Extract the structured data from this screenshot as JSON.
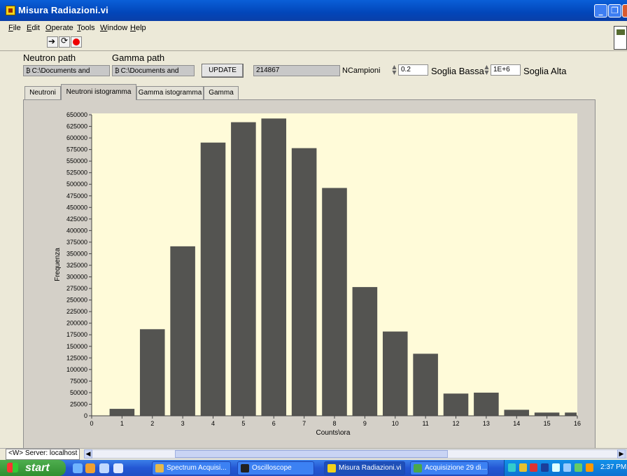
{
  "window": {
    "title": "Misura Radiazioni.vi"
  },
  "menu": [
    {
      "label": "File",
      "u": "F",
      "rest": "ile"
    },
    {
      "label": "Edit",
      "u": "E",
      "rest": "dit"
    },
    {
      "label": "Operate",
      "u": "O",
      "rest": "perate"
    },
    {
      "label": "Tools",
      "u": "T",
      "rest": "ools"
    },
    {
      "label": "Window",
      "u": "W",
      "rest": "indow"
    },
    {
      "label": "Help",
      "u": "H",
      "rest": "elp"
    }
  ],
  "controls": {
    "neutron_path_label": "Neutron path",
    "neutron_path_value": "C:\\Documents and",
    "gamma_path_label": "Gamma path",
    "gamma_path_value": "C:\\Documents and",
    "update_label": "UPDATE",
    "ncampioni_value": "214867",
    "ncampioni_label": "NCampioni",
    "soglia_bassa_value": "0.2",
    "soglia_bassa_label": "Soglia Bassa",
    "soglia_alta_value": "1E+6",
    "soglia_alta_label": "Soglia Alta"
  },
  "tabs": [
    "Neutroni",
    "Neutroni istogramma",
    "Gamma istogramma",
    "Gamma"
  ],
  "active_tab": 1,
  "chart_data": {
    "type": "bar",
    "categories": [
      1,
      2,
      3,
      4,
      5,
      6,
      7,
      8,
      9,
      10,
      11,
      12,
      13,
      14,
      15,
      16
    ],
    "values": [
      15000,
      187000,
      366000,
      590000,
      634000,
      642000,
      578000,
      492000,
      278000,
      182000,
      134000,
      48000,
      50000,
      13000,
      7000,
      7000
    ],
    "xlabel": "Counts\\ora",
    "ylabel": "Frequenza",
    "xlim": [
      0,
      16
    ],
    "ylim": [
      0,
      650000
    ],
    "y_tick_step": 25000,
    "x_ticks": [
      0,
      1,
      2,
      3,
      4,
      5,
      6,
      7,
      8,
      9,
      10,
      11,
      12,
      13,
      14,
      15,
      16
    ],
    "bar_color": "#545451",
    "plot_background": "#fffbd9",
    "grid": false
  },
  "status": {
    "server": "<W> Server: localhost"
  },
  "taskbar": {
    "start": "start",
    "tasks": [
      {
        "label": "Spectrum Acquisi...",
        "active": false
      },
      {
        "label": "Oscilloscope",
        "active": false
      },
      {
        "label": "Misura Radiazioni.vi",
        "active": true
      },
      {
        "label": "Acquisizione 29 di...",
        "active": false
      }
    ],
    "clock": "2:37 PM"
  }
}
